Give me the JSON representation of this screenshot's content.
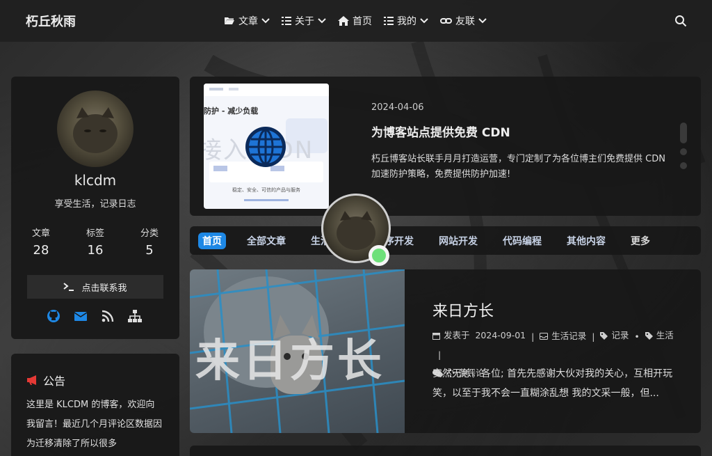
{
  "site": {
    "title": "朽丘秋雨"
  },
  "nav": {
    "items": [
      {
        "label": "文章",
        "icon": "folder-open-icon",
        "dropdown": true
      },
      {
        "label": "关于",
        "icon": "list-icon",
        "dropdown": true
      },
      {
        "label": "首页",
        "icon": "home-icon",
        "dropdown": false
      },
      {
        "label": "我的",
        "icon": "list-icon",
        "dropdown": true
      },
      {
        "label": "友联",
        "icon": "link-icon",
        "dropdown": true
      }
    ],
    "search_icon": "search-icon"
  },
  "profile": {
    "name": "klcdm",
    "motto": "享受生活，记录日志",
    "stats": [
      {
        "label": "文章",
        "value": "28"
      },
      {
        "label": "标签",
        "value": "16"
      },
      {
        "label": "分类",
        "value": "5"
      }
    ],
    "contact_label": "点击联系我",
    "social": [
      "github-icon",
      "mail-icon",
      "rss-icon",
      "sitemap-icon"
    ],
    "social_color": "#1e88e5"
  },
  "notice": {
    "title": "公告",
    "icon": "bullhorn-icon",
    "icon_color": "#e53935",
    "body": "这里是 KLCDM 的博客，欢迎向我留言！最近几个月评论区数据因为迁移清除了所以很多"
  },
  "featured": {
    "date": "2024-04-06",
    "title": "为博客站点提供免费 CDN",
    "desc": "朽丘博客站长联手月月打造运营，专门定制了为各位博主们免费提供 CDN 加速防护策略，免费提供防护加速!",
    "image_text_1": "防护 - 减少负载",
    "image_text_2": "接入 CDN",
    "image_text_3": "稳定、安全、可信的产品与服务",
    "image_icon": "globe-icon"
  },
  "tabs": {
    "items": [
      "首页",
      "全部文章",
      "生活记录",
      "程序开发",
      "网站开发",
      "代码编程",
      "其他内容",
      "更多"
    ],
    "active_index": 0,
    "active_color": "#1e88e5"
  },
  "post": {
    "title": "来日方长",
    "image_text": "来日方长",
    "meta": {
      "posted_label": "发表于",
      "date": "2024-09-01",
      "category": "生活记录",
      "tags": [
        "记录",
        "生活"
      ],
      "comments_suffix": "条评论"
    },
    "excerpt": "安然无恙，各位; 首先先感谢大伙对我的关心，互相开玩笑，以至于我不会一直糊涂乱想 我的文采一般，但..."
  },
  "status": {
    "online_color": "#6ee07a"
  }
}
